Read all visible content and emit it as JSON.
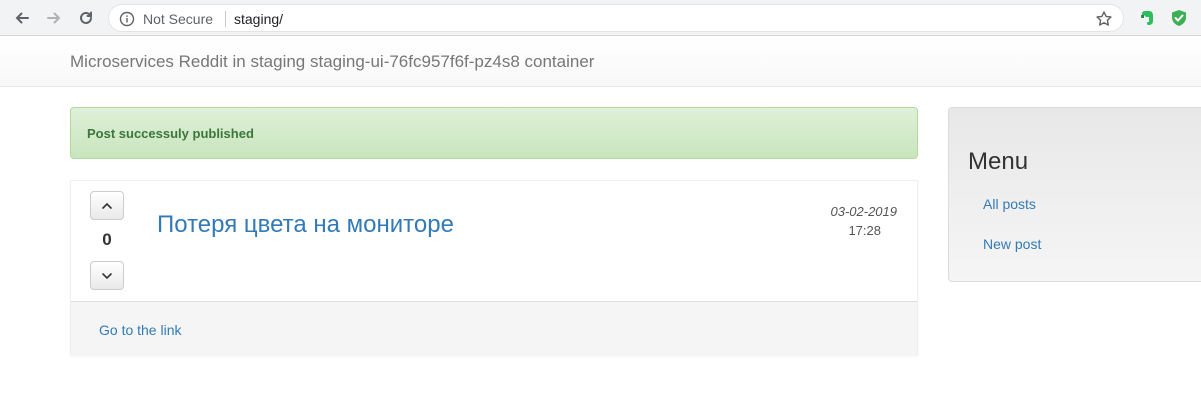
{
  "browser": {
    "security_label": "Not Secure",
    "url": "staging/"
  },
  "navbar": {
    "brand": "Microservices Reddit in staging staging-ui-76fc957f6f-pz4s8 container"
  },
  "alert": {
    "message": "Post successuly published",
    "color": "#3c763d"
  },
  "post": {
    "votes": "0",
    "title": "Потеря цвета на мониторе",
    "date": "03-02-2019",
    "time": "17:28",
    "link_label": "Go to the link"
  },
  "sidebar": {
    "title": "Menu",
    "items": [
      {
        "label": "All posts"
      },
      {
        "label": "New post"
      }
    ]
  },
  "colors": {
    "link": "#337ab7",
    "alert_bg": "#dff0d8"
  }
}
